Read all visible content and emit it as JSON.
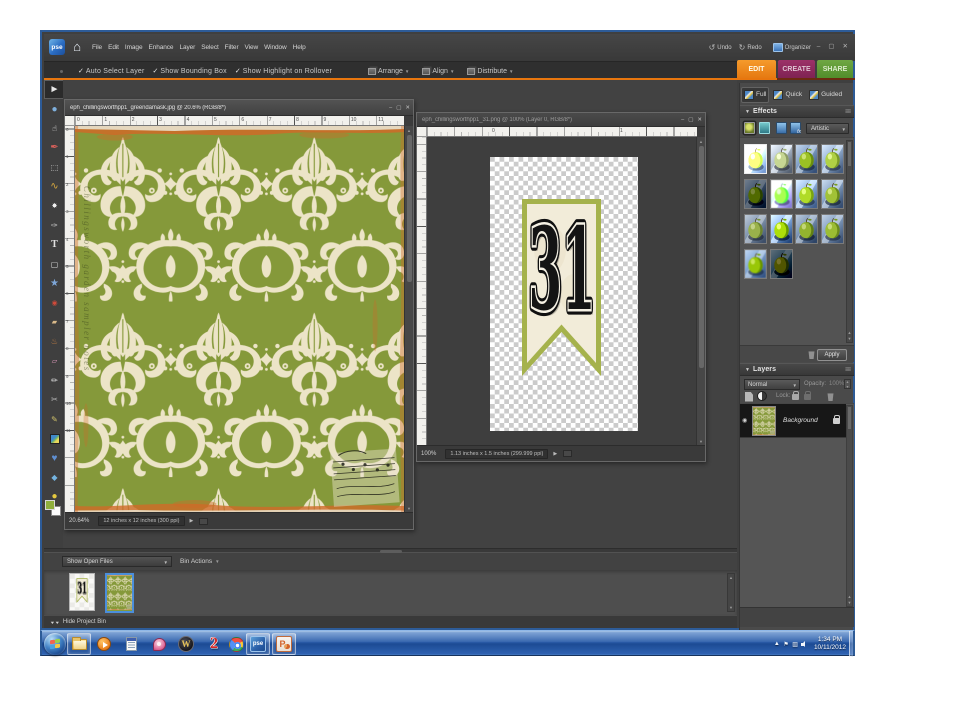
{
  "app": {
    "logo": "pse",
    "menus": [
      "File",
      "Edit",
      "Image",
      "Enhance",
      "Layer",
      "Select",
      "Filter",
      "View",
      "Window",
      "Help"
    ],
    "undo_label": "Undo",
    "redo_label": "Redo",
    "organizer_label": "Organizer"
  },
  "optionsbar": {
    "checkboxes": [
      "Auto Select Layer",
      "Show Bounding Box",
      "Show Highlight on Rollover"
    ],
    "buttons": [
      "Arrange",
      "Align",
      "Distribute"
    ]
  },
  "tabs": {
    "edit": "EDIT",
    "create": "CREATE",
    "share": "SHARE"
  },
  "modes": {
    "full": "Full",
    "quick": "Quick",
    "guided": "Guided"
  },
  "tools": [
    {
      "name": "move",
      "glyph": "►"
    },
    {
      "name": "zoom",
      "glyph": "●"
    },
    {
      "name": "hand",
      "glyph": "☝"
    },
    {
      "name": "eyedropper",
      "glyph": "✒"
    },
    {
      "name": "marquee",
      "glyph": "⬚"
    },
    {
      "name": "lasso",
      "glyph": "∿"
    },
    {
      "name": "magic-wand",
      "glyph": "✸"
    },
    {
      "name": "quick-selection",
      "glyph": "✑"
    },
    {
      "name": "type",
      "glyph": "T"
    },
    {
      "name": "crop",
      "glyph": "▢"
    },
    {
      "name": "cookie-cutter",
      "glyph": "★"
    },
    {
      "name": "red-eye-removal",
      "glyph": "◉"
    },
    {
      "name": "healing-brush",
      "glyph": "▰"
    },
    {
      "name": "clone-stamp",
      "glyph": "♨"
    },
    {
      "name": "eraser",
      "glyph": "▱"
    },
    {
      "name": "brush",
      "glyph": "✏"
    },
    {
      "name": "smart-brush",
      "glyph": "✂"
    },
    {
      "name": "pencil",
      "glyph": "✎"
    },
    {
      "name": "gradient",
      "glyph": ""
    },
    {
      "name": "shape",
      "glyph": "♥"
    },
    {
      "name": "blur",
      "glyph": "◆"
    },
    {
      "name": "sponge",
      "glyph": "●"
    }
  ],
  "effects": {
    "title": "Effects",
    "category": "Artistic",
    "apply_label": "Apply",
    "thumbnails": [
      "effect-1",
      "effect-2",
      "effect-3",
      "effect-4",
      "effect-5",
      "effect-6",
      "effect-7",
      "effect-8",
      "effect-9",
      "effect-10",
      "effect-11",
      "effect-12",
      "effect-13",
      "effect-14"
    ]
  },
  "layers": {
    "title": "Layers",
    "blend_mode": "Normal",
    "opacity_label": "Opacity:",
    "opacity_value": "100%",
    "lock_label": "Lock:",
    "layer_name": "Background"
  },
  "documents": [
    {
      "title": "eph_chillingsworthpp1_greendamask.jpg @ 20.6% (RGB/8*)",
      "zoom": "20.64%",
      "dimensions": "12 inches x 12 inches (300 ppi)",
      "edge_scribble": "Chillingsworth garden sampler notes",
      "ruler_numbers": [
        "0",
        "1",
        "2",
        "3",
        "4",
        "5",
        "6",
        "7",
        "8",
        "9",
        "10",
        "11"
      ]
    },
    {
      "title": "eph_chillingsworthpp1_31.png @ 100% (Layer 0, RGB/8*)",
      "zoom": "100%",
      "dimensions": "1.13 inches x 1.5 inches (299.999 ppi)",
      "ruler_numbers": [
        "0",
        "1"
      ],
      "banner_number": "31"
    }
  ],
  "project_bin": {
    "show_open_files": "Show Open Files",
    "bin_actions": "Bin Actions",
    "hide_label": "Hide Project Bin"
  },
  "taskbar": {
    "time": "1:34 PM",
    "wow_glyph": "W",
    "app2_glyph": "2",
    "date": "10/11/2012",
    "apps": [
      "start",
      "explorer",
      "media-player",
      "notepad",
      "photo-app",
      "wow",
      "heroes2",
      "chrome",
      "photoshop-elements",
      "powerpoint"
    ]
  },
  "colors": {
    "accent_orange": "#e8760e",
    "tab_create": "#8e2a5c",
    "tab_share": "#5d9733",
    "damask_green": "#85993a",
    "damask_cream": "#ece4c7",
    "grunge_orange": "#cf6a28",
    "banner_olive": "#a5b24c",
    "banner_cream": "#f2ecd9",
    "selection_blue": "#4b8edb"
  }
}
